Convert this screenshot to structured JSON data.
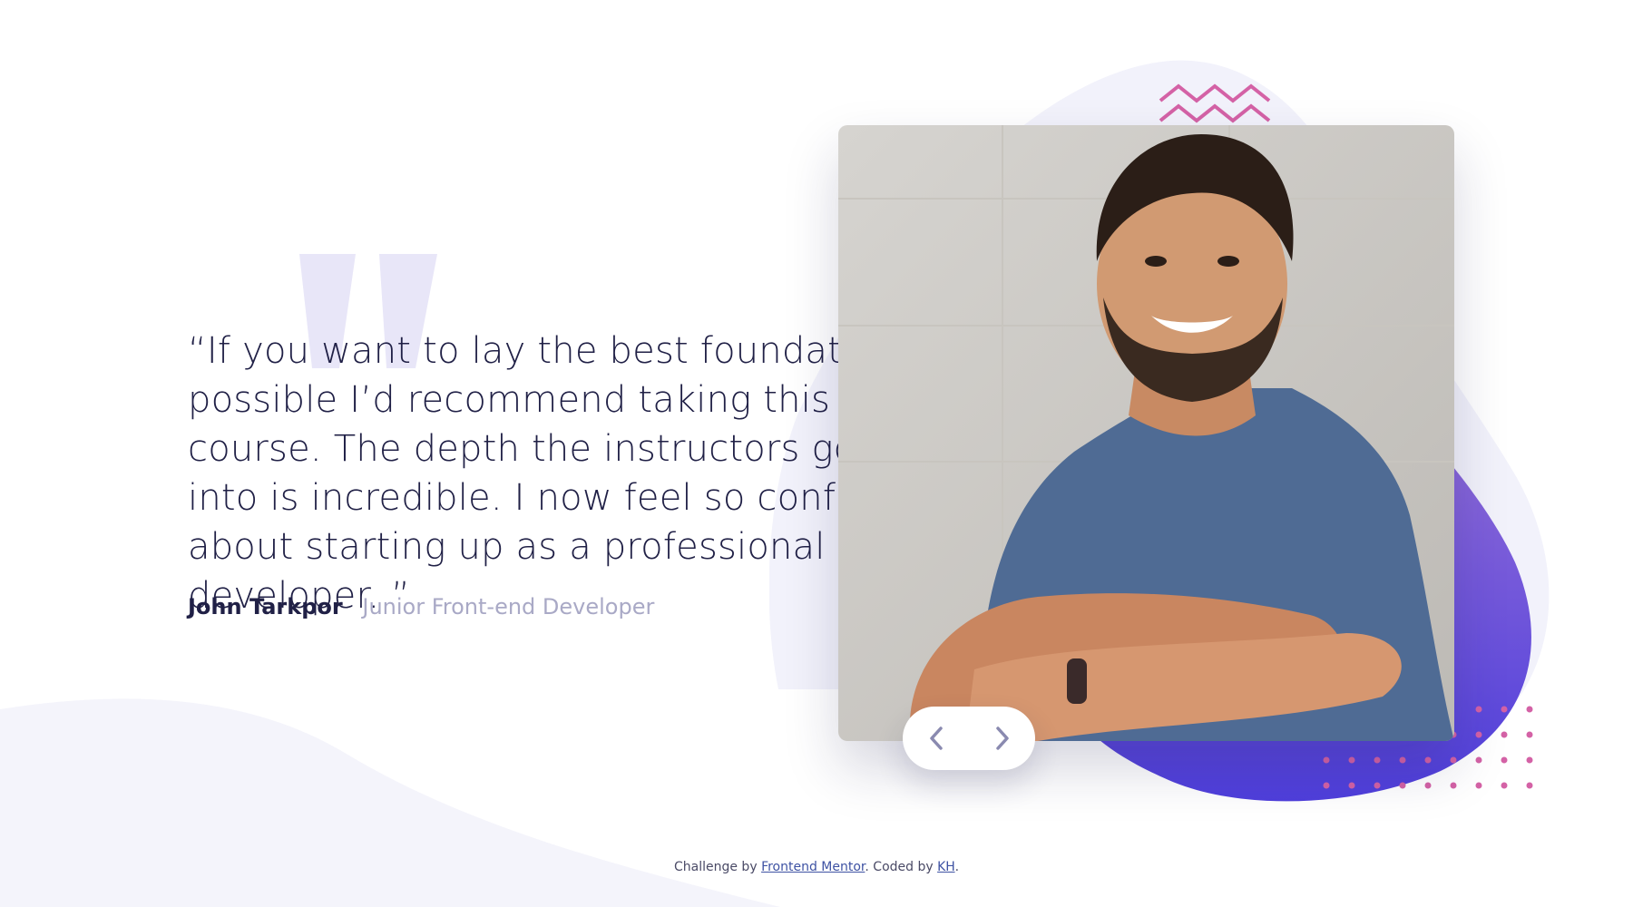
{
  "testimonial": {
    "quote": "“If you want to lay the best foundation possible I’d recommend taking this course. The depth the instructors go into is incredible. I now feel so confident about starting up as a professional developer. ”",
    "name": "John Tarkpor",
    "role": "Junior Front-end Developer"
  },
  "slider": {
    "prev_icon": "chevron-left-icon",
    "next_icon": "chevron-right-icon"
  },
  "attribution": {
    "prefix": "Challenge by ",
    "link1": "Frontend Mentor",
    "middle": ". Coded by ",
    "link2": "KH",
    "suffix": "."
  },
  "colors": {
    "dark_navy": "#202046",
    "grayish_blue": "#a9a9c6",
    "light_bg": "#f4f4fb",
    "quote_mark": "#e8e6f8",
    "blob_top": "#9b73d8",
    "blob_bottom": "#4f3fdc",
    "accent_pink": "#d462a6"
  }
}
